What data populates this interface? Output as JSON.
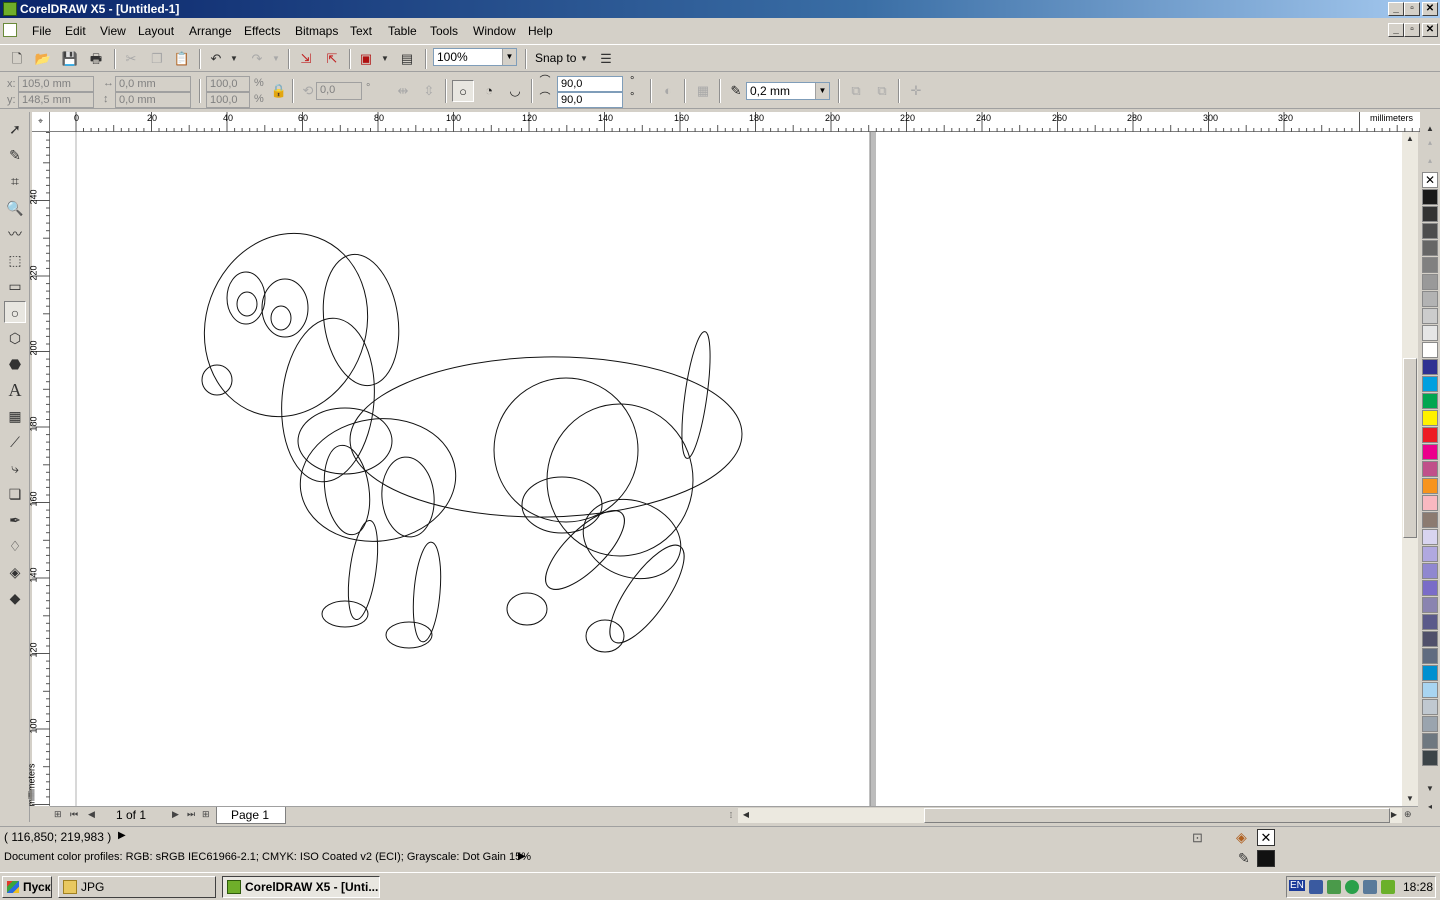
{
  "window": {
    "title": "CorelDRAW X5 - [Untitled-1]",
    "minimize": "_",
    "restore": "▫",
    "close": "✕"
  },
  "menu": [
    "File",
    "Edit",
    "View",
    "Layout",
    "Arrange",
    "Effects",
    "Bitmaps",
    "Text",
    "Table",
    "Tools",
    "Window",
    "Help"
  ],
  "toolbar": {
    "zoom_level": "100%",
    "snap_label": "Snap to"
  },
  "properties": {
    "x_label": "x:",
    "y_label": "y:",
    "x_value": "105,0 mm",
    "y_value": "148,5 mm",
    "width_value": "0,0 mm",
    "height_value": "0,0 mm",
    "scale_w": "100,0",
    "scale_h": "100,0",
    "percent": "%",
    "rotation": "0,0",
    "degree": "°",
    "start_angle": "90,0",
    "end_angle": "90,0",
    "outline_width": "0,2 mm"
  },
  "rulers": {
    "unit": "millimeters",
    "h_ticks": [
      "0",
      "20",
      "40",
      "60",
      "80",
      "100",
      "120",
      "140",
      "160",
      "180",
      "200",
      "220",
      "240",
      "260",
      "280",
      "300",
      "320"
    ],
    "v_ticks": [
      "240",
      "220",
      "200",
      "180",
      "160",
      "140",
      "120",
      "100"
    ]
  },
  "pages": {
    "counter": "1 of 1",
    "tab": "Page 1"
  },
  "status": {
    "cursor_coords": "( 116,850; 219,983 )",
    "color_profiles": "Document color profiles: RGB: sRGB IEC61966-2.1; CMYK: ISO Coated v2 (ECI); Grayscale: Dot Gain 15%"
  },
  "palette": [
    "#1a1a1a",
    "#333333",
    "#4d4d4d",
    "#666666",
    "#808080",
    "#999999",
    "#b3b3b3",
    "#cccccc",
    "#e6e6e6",
    "#ffffff",
    "#2e3192",
    "#00a0e0",
    "#00a651",
    "#fff200",
    "#ed1c24",
    "#ec008c",
    "#c0508a",
    "#f7941d",
    "#f9b8c0",
    "#8c7b70",
    "#d8d4f0",
    "#b0a8e0",
    "#9088d0",
    "#7a6cc8",
    "#8a84b0",
    "#5a5a8a",
    "#50506a",
    "#606c80",
    "#0090d0",
    "#a8d4f0",
    "#c0c8d0",
    "#9aa4ae",
    "#6e7880",
    "#3c4448"
  ],
  "taskbar": {
    "start": "Пуск",
    "tasks": [
      "JPG",
      "CorelDRAW X5 - [Unti..."
    ],
    "lang": "EN",
    "clock": "18:28"
  }
}
